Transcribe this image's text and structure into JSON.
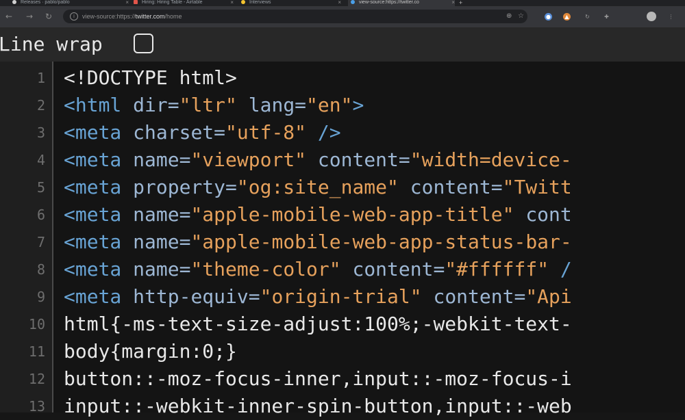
{
  "tabs": [
    {
      "title": "Releases · pablo/pablo",
      "favicon_color": "#d0d0d0",
      "active": false
    },
    {
      "title": "Hiring: Hiring Table - Airtable",
      "favicon_color": "#e2554a",
      "active": false
    },
    {
      "title": "Interviews",
      "favicon_color": "#f4c430",
      "active": false
    },
    {
      "title": "view-source:https://twitter.co",
      "favicon_color": "#4a9fe8",
      "active": true
    }
  ],
  "new_tab_label": "+",
  "address_bar": {
    "prefix": "view-source:https://",
    "host": "twitter.com",
    "path": "/home"
  },
  "line_wrap": {
    "label": "Line wrap",
    "checked": false
  },
  "source_lines": [
    {
      "num": "1",
      "segments": [
        {
          "t": "<!DOCTYPE html>",
          "c": "plain"
        }
      ]
    },
    {
      "num": "2",
      "segments": [
        {
          "t": "<html ",
          "c": "tag"
        },
        {
          "t": "dir=",
          "c": "attr"
        },
        {
          "t": "\"ltr\"",
          "c": "val"
        },
        {
          "t": " lang=",
          "c": "attr"
        },
        {
          "t": "\"en\"",
          "c": "val"
        },
        {
          "t": ">",
          "c": "tag"
        }
      ]
    },
    {
      "num": "3",
      "segments": [
        {
          "t": "<meta ",
          "c": "tag"
        },
        {
          "t": "charset=",
          "c": "attr"
        },
        {
          "t": "\"utf-8\"",
          "c": "val"
        },
        {
          "t": " />",
          "c": "tag"
        }
      ]
    },
    {
      "num": "4",
      "segments": [
        {
          "t": "<meta ",
          "c": "tag"
        },
        {
          "t": "name=",
          "c": "attr"
        },
        {
          "t": "\"viewport\"",
          "c": "val"
        },
        {
          "t": " content=",
          "c": "attr"
        },
        {
          "t": "\"width=device-",
          "c": "val"
        }
      ]
    },
    {
      "num": "5",
      "segments": [
        {
          "t": "<meta ",
          "c": "tag"
        },
        {
          "t": "property=",
          "c": "attr"
        },
        {
          "t": "\"og:site_name\"",
          "c": "val"
        },
        {
          "t": " content=",
          "c": "attr"
        },
        {
          "t": "\"Twitt",
          "c": "val"
        }
      ]
    },
    {
      "num": "6",
      "segments": [
        {
          "t": "<meta ",
          "c": "tag"
        },
        {
          "t": "name=",
          "c": "attr"
        },
        {
          "t": "\"apple-mobile-web-app-title\"",
          "c": "val"
        },
        {
          "t": " cont",
          "c": "attr"
        }
      ]
    },
    {
      "num": "7",
      "segments": [
        {
          "t": "<meta ",
          "c": "tag"
        },
        {
          "t": "name=",
          "c": "attr"
        },
        {
          "t": "\"apple-mobile-web-app-status-bar-",
          "c": "val"
        }
      ]
    },
    {
      "num": "8",
      "segments": [
        {
          "t": "<meta ",
          "c": "tag"
        },
        {
          "t": "name=",
          "c": "attr"
        },
        {
          "t": "\"theme-color\"",
          "c": "val"
        },
        {
          "t": " content=",
          "c": "attr"
        },
        {
          "t": "\"#ffffff\"",
          "c": "val"
        },
        {
          "t": " /",
          "c": "tag"
        }
      ]
    },
    {
      "num": "9",
      "segments": [
        {
          "t": "<meta ",
          "c": "tag"
        },
        {
          "t": "http-equiv=",
          "c": "attr"
        },
        {
          "t": "\"origin-trial\"",
          "c": "val"
        },
        {
          "t": " content=",
          "c": "attr"
        },
        {
          "t": "\"Api",
          "c": "val"
        }
      ]
    },
    {
      "num": "10",
      "segments": [
        {
          "t": "html{-ms-text-size-adjust:100%;-webkit-text-",
          "c": "plain"
        }
      ]
    },
    {
      "num": "11",
      "segments": [
        {
          "t": "body{margin:0;}",
          "c": "plain"
        }
      ]
    },
    {
      "num": "12",
      "segments": [
        {
          "t": "button::-moz-focus-inner,input::-moz-focus-i",
          "c": "plain"
        }
      ]
    },
    {
      "num": "13",
      "segments": [
        {
          "t": "input::-webkit-inner-spin-button,input::-web",
          "c": "plain"
        }
      ]
    }
  ]
}
